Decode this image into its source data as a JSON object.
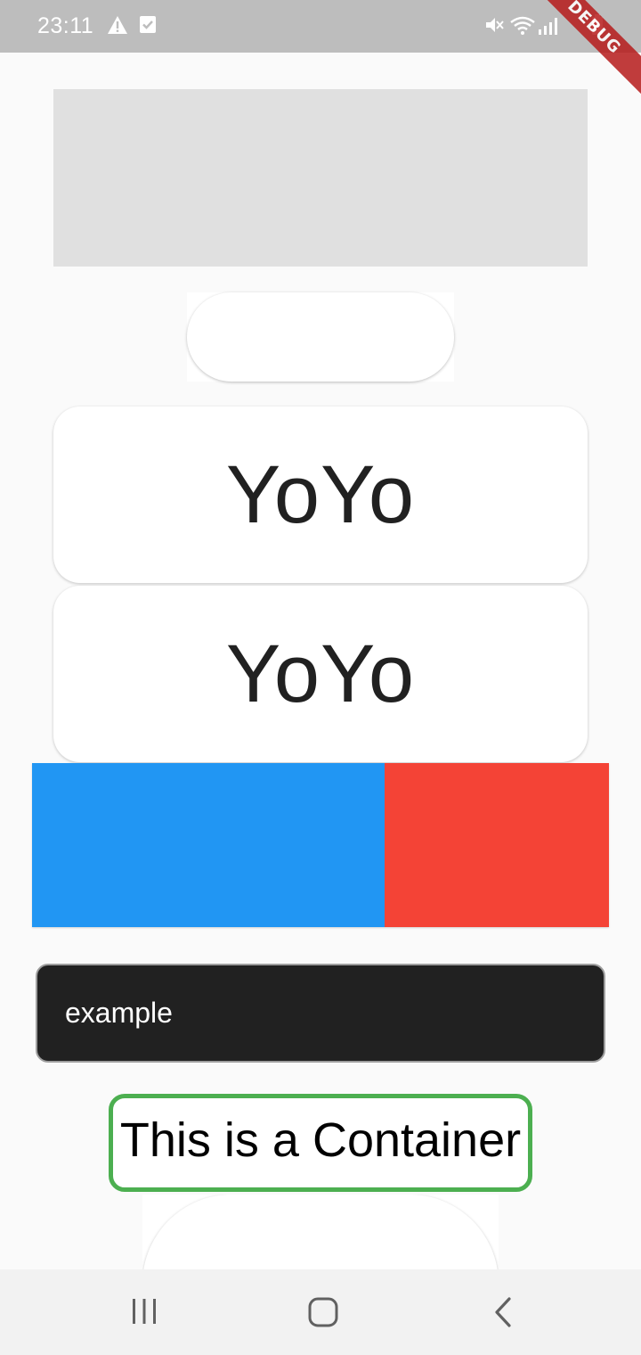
{
  "status_bar": {
    "time": "23:11",
    "left_icons": [
      "warning-icon",
      "checkbox-notification-icon"
    ],
    "right_icons": [
      "mute-icon",
      "wifi-icon",
      "signal-icon",
      "battery-icon"
    ],
    "debug_banner": "DEBUG"
  },
  "cards": [
    {
      "label": "YoYo"
    },
    {
      "label": "YoYo"
    }
  ],
  "color_row": {
    "left_color": "#2196f3",
    "right_color": "#f44336"
  },
  "text_field": {
    "value": "example"
  },
  "container": {
    "text": "This is a Container",
    "border_color": "#4caf50"
  },
  "nav_bar": {
    "buttons": [
      "recents-icon",
      "home-icon",
      "back-icon"
    ]
  }
}
